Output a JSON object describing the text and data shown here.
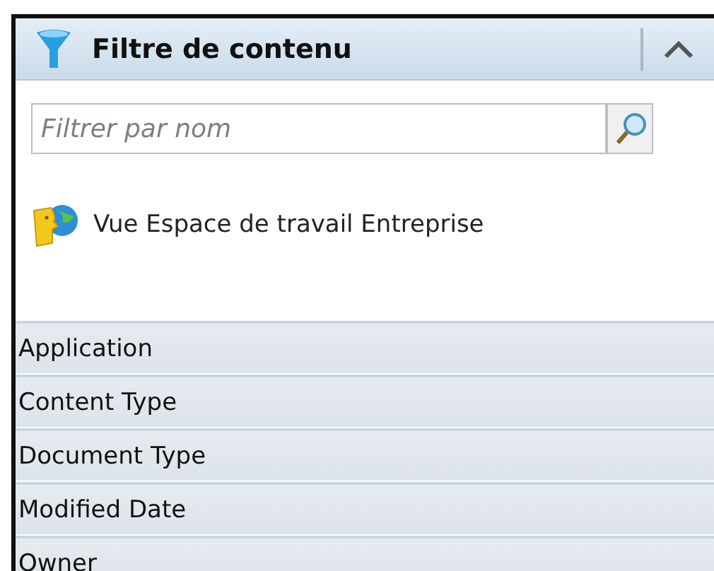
{
  "panel": {
    "title": "Filtre de contenu",
    "expanded": true
  },
  "search": {
    "placeholder": "Filtrer par nom"
  },
  "view_item": {
    "label": "Vue Espace de travail Entreprise"
  },
  "categories": [
    {
      "label": "Application"
    },
    {
      "label": "Content Type"
    },
    {
      "label": "Document Type"
    },
    {
      "label": "Modified Date"
    },
    {
      "label": "Owner"
    }
  ]
}
